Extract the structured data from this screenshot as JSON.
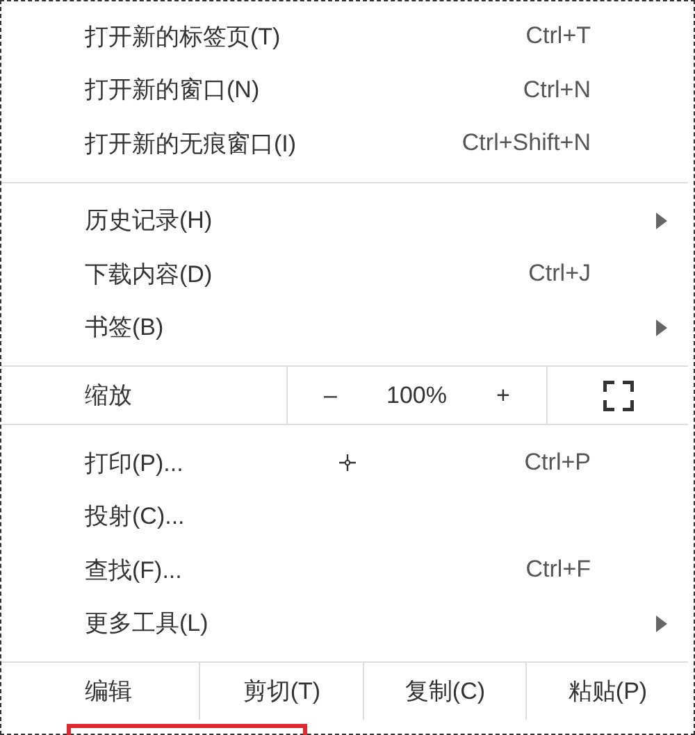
{
  "menu": {
    "sections": [
      {
        "kind": "items",
        "items": [
          {
            "label": "打开新的标签页(T)",
            "shortcut": "Ctrl+T",
            "submenu": false
          },
          {
            "label": "打开新的窗口(N)",
            "shortcut": "Ctrl+N",
            "submenu": false
          },
          {
            "label": "打开新的无痕窗口(I)",
            "shortcut": "Ctrl+Shift+N",
            "submenu": false
          }
        ]
      },
      {
        "kind": "items",
        "items": [
          {
            "label": "历史记录(H)",
            "submenu": true
          },
          {
            "label": "下载内容(D)",
            "shortcut": "Ctrl+J",
            "submenu": false
          },
          {
            "label": "书签(B)",
            "submenu": true
          }
        ]
      },
      {
        "kind": "zoom",
        "label": "缩放",
        "minus": "–",
        "value": "100%",
        "plus": "+"
      },
      {
        "kind": "items",
        "items": [
          {
            "label": "打印(P)...",
            "shortcut": "Ctrl+P",
            "submenu": false
          },
          {
            "label": "投射(C)...",
            "submenu": false
          },
          {
            "label": "查找(F)...",
            "shortcut": "Ctrl+F",
            "submenu": false
          },
          {
            "label": "更多工具(L)",
            "submenu": true
          }
        ]
      },
      {
        "kind": "edit",
        "label": "编辑",
        "buttons": [
          "剪切(T)",
          "复制(C)",
          "粘贴(P)"
        ]
      }
    ]
  }
}
